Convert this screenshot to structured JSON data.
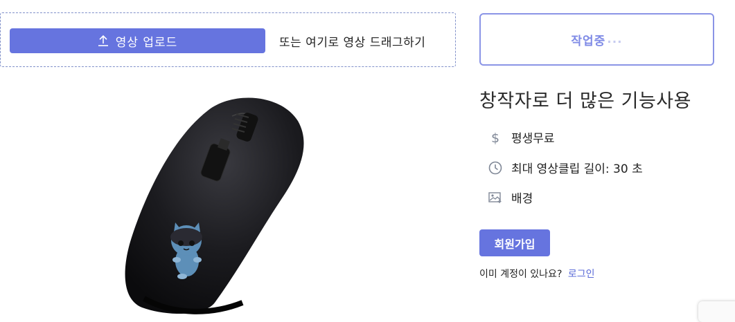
{
  "upload": {
    "button_label": "영상 업로드",
    "drag_hint": "또는 여기로 영상 드래그하기"
  },
  "status": {
    "label": "작업중",
    "dots": "..."
  },
  "promo": {
    "title": "창작자로 더 많은 기능사용",
    "features": [
      {
        "icon": "dollar-icon",
        "label": "평생무료"
      },
      {
        "icon": "clock-icon",
        "label": "최대 영상클립 길이: 30 초"
      },
      {
        "icon": "image-icon",
        "label": "배경"
      }
    ],
    "signup_label": "회원가입",
    "login_prompt": "이미 계정이 있나요?",
    "login_link": "로그인"
  },
  "colors": {
    "accent": "#6674df",
    "status_text": "#7f8be6",
    "icon_gray": "#7f8796"
  }
}
